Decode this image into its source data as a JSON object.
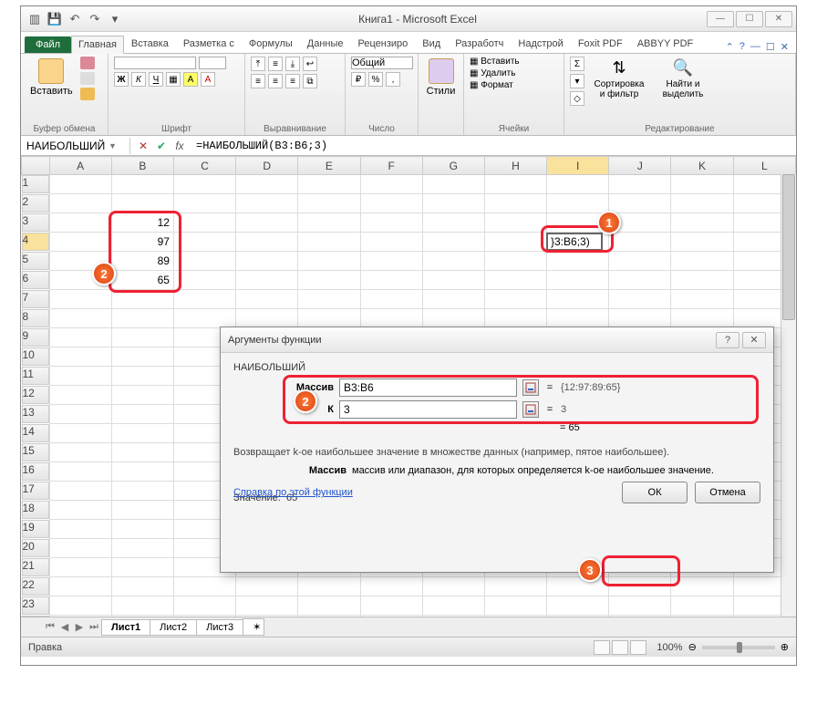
{
  "window": {
    "title": "Книга1 - Microsoft Excel"
  },
  "ribbon": {
    "file": "Файл",
    "tabs": [
      "Главная",
      "Вставка",
      "Разметка с",
      "Формулы",
      "Данные",
      "Рецензиро",
      "Вид",
      "Разработч",
      "Надстрой",
      "Foxit PDF",
      "ABBYY PDF"
    ],
    "active_tab": 0,
    "groups": {
      "clipboard": {
        "paste": "Вставить",
        "label": "Буфер обмена"
      },
      "font": {
        "name": "",
        "size": "",
        "label": "Шрифт"
      },
      "align": {
        "label": "Выравнивание"
      },
      "number": {
        "format": "Общий",
        "label": "Число"
      },
      "styles": {
        "btn": "Стили",
        "label": ""
      },
      "cells": {
        "insert": "Вставить",
        "delete": "Удалить",
        "format": "Формат",
        "label": "Ячейки"
      },
      "editing": {
        "sort": "Сортировка и фильтр",
        "find": "Найти и выделить",
        "label": "Редактирование"
      }
    }
  },
  "formula_bar": {
    "namebox": "НАИБОЛЬШИЙ",
    "formula": "=НАИБОЛЬШИЙ(B3:B6;3)"
  },
  "columns": [
    "A",
    "B",
    "C",
    "D",
    "E",
    "F",
    "G",
    "H",
    "I",
    "J",
    "K",
    "L"
  ],
  "rows_shown": 26,
  "data_cells": {
    "B3": "12",
    "B4": "97",
    "B5": "89",
    "B6": "65"
  },
  "active_cell": {
    "ref": "I4",
    "display": "}3:B6;3)"
  },
  "dialog": {
    "title": "Аргументы функции",
    "func": "НАИБОЛЬШИЙ",
    "args": [
      {
        "label": "Массив",
        "value": "B3:B6",
        "result": "{12:97:89:65}"
      },
      {
        "label": "К",
        "value": "3",
        "result": "3"
      }
    ],
    "result_eq": "= 65",
    "desc": "Возвращает k-ое наибольшее значение в множестве данных (например, пятое наибольшее).",
    "arg_desc_label": "Массив",
    "arg_desc": "массив или диапазон, для которых определяется k-ое наибольшее значение.",
    "value_label": "Значение:",
    "value": "65",
    "help": "Справка по этой функции",
    "ok": "ОК",
    "cancel": "Отмена"
  },
  "sheets": {
    "tabs": [
      "Лист1",
      "Лист2",
      "Лист3"
    ],
    "active": 0
  },
  "statusbar": {
    "mode": "Правка",
    "zoom": "100%"
  },
  "badges": {
    "n1": "1",
    "n2": "2",
    "n2b": "2",
    "n3": "3"
  }
}
